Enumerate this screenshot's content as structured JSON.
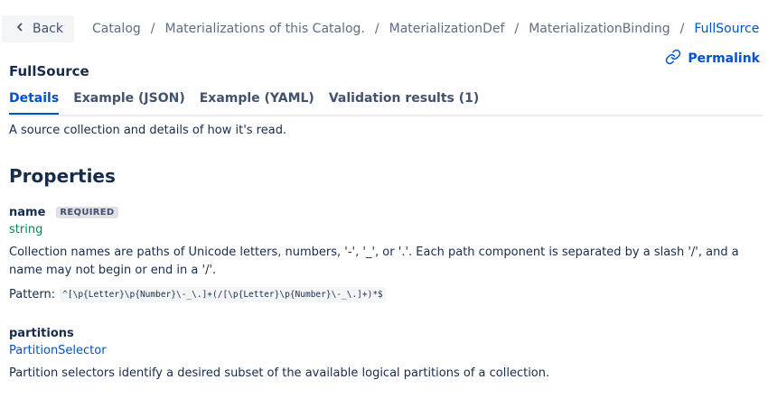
{
  "back_label": "Back",
  "breadcrumbs": [
    "Catalog",
    "Materializations of this Catalog.",
    "MaterializationDef",
    "MaterializationBinding",
    "FullSource"
  ],
  "breadcrumb_separator": "/",
  "permalink_label": "Permalink",
  "page_title": "FullSource",
  "tabs": [
    "Details",
    "Example (JSON)",
    "Example (YAML)",
    "Validation results (1)"
  ],
  "active_tab": "Details",
  "description": "A source collection and details of how it's read.",
  "section_title": "Properties",
  "properties": [
    {
      "name": "name",
      "badge": "REQUIRED",
      "type": "string",
      "description": "Collection names are paths of Unicode letters, numbers, '-', '_', or '.'. Each path component is separated by a slash '/', and a name may not begin or end in a '/'.",
      "pattern_label": "Pattern:",
      "pattern": "^[\\p{Letter}\\p{Number}\\-_\\.]+(/[\\p{Letter}\\p{Number}\\-_\\.]+)*$"
    },
    {
      "name": "partitions",
      "type": "PartitionSelector",
      "description": "Partition selectors identify a desired subset of the available logical partitions of a collection."
    }
  ],
  "colors": {
    "link": "#0052cc",
    "type_string": "#00875a",
    "text": "#172b4d"
  }
}
